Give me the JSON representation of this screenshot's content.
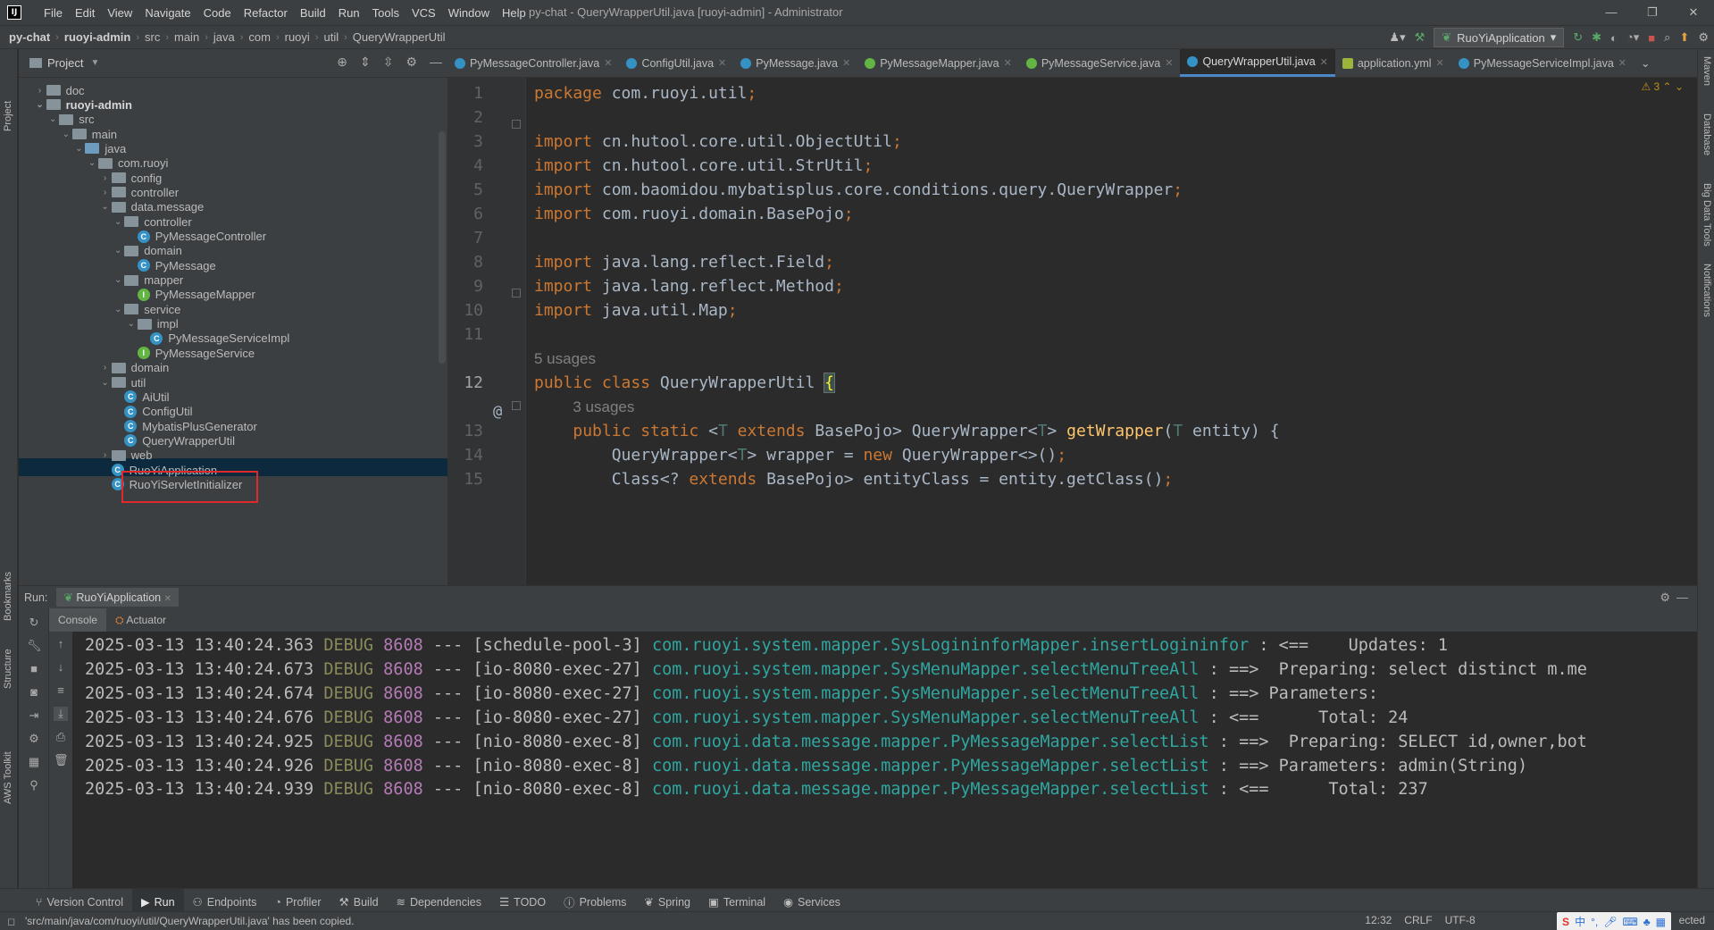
{
  "window": {
    "title": "py-chat - QueryWrapperUtil.java [ruoyi-admin] - Administrator",
    "menus": [
      "File",
      "Edit",
      "View",
      "Navigate",
      "Code",
      "Refactor",
      "Build",
      "Run",
      "Tools",
      "VCS",
      "Window",
      "Help"
    ],
    "controls": [
      "—",
      "❐",
      "✕"
    ]
  },
  "breadcrumb": [
    "py-chat",
    "ruoyi-admin",
    "src",
    "main",
    "java",
    "com",
    "ruoyi",
    "util",
    "QueryWrapperUtil"
  ],
  "run_config": "RuoYiApplication",
  "project_panel": {
    "title": "Project",
    "tree": [
      {
        "label": "doc",
        "depth": 1,
        "type": "folder",
        "arrow": "›"
      },
      {
        "label": "ruoyi-admin",
        "depth": 1,
        "type": "module",
        "arrow": "⌄"
      },
      {
        "label": "src",
        "depth": 2,
        "type": "folder",
        "arrow": "⌄"
      },
      {
        "label": "main",
        "depth": 3,
        "type": "folder",
        "arrow": "⌄"
      },
      {
        "label": "java",
        "depth": 4,
        "type": "source",
        "arrow": "⌄"
      },
      {
        "label": "com.ruoyi",
        "depth": 5,
        "type": "package",
        "arrow": "⌄"
      },
      {
        "label": "config",
        "depth": 6,
        "type": "package",
        "arrow": "›"
      },
      {
        "label": "controller",
        "depth": 6,
        "type": "package",
        "arrow": "›"
      },
      {
        "label": "data.message",
        "depth": 6,
        "type": "package",
        "arrow": "⌄"
      },
      {
        "label": "controller",
        "depth": 7,
        "type": "package",
        "arrow": "⌄"
      },
      {
        "label": "PyMessageController",
        "depth": 8,
        "type": "class",
        "arrow": ""
      },
      {
        "label": "domain",
        "depth": 7,
        "type": "package",
        "arrow": "⌄"
      },
      {
        "label": "PyMessage",
        "depth": 8,
        "type": "class",
        "arrow": ""
      },
      {
        "label": "mapper",
        "depth": 7,
        "type": "package",
        "arrow": "⌄"
      },
      {
        "label": "PyMessageMapper",
        "depth": 8,
        "type": "interface",
        "arrow": ""
      },
      {
        "label": "service",
        "depth": 7,
        "type": "package",
        "arrow": "⌄"
      },
      {
        "label": "impl",
        "depth": 8,
        "type": "package",
        "arrow": "⌄"
      },
      {
        "label": "PyMessageServiceImpl",
        "depth": 9,
        "type": "class",
        "arrow": ""
      },
      {
        "label": "PyMessageService",
        "depth": 8,
        "type": "interface",
        "arrow": ""
      },
      {
        "label": "domain",
        "depth": 6,
        "type": "package",
        "arrow": "›"
      },
      {
        "label": "util",
        "depth": 6,
        "type": "package",
        "arrow": "⌄"
      },
      {
        "label": "AiUtil",
        "depth": 7,
        "type": "class",
        "arrow": ""
      },
      {
        "label": "ConfigUtil",
        "depth": 7,
        "type": "class",
        "arrow": ""
      },
      {
        "label": "MybatisPlusGenerator",
        "depth": 7,
        "type": "class",
        "arrow": ""
      },
      {
        "label": "QueryWrapperUtil",
        "depth": 7,
        "type": "class",
        "arrow": "",
        "selected": true
      },
      {
        "label": "web",
        "depth": 6,
        "type": "package",
        "arrow": "›"
      },
      {
        "label": "RuoYiApplication",
        "depth": 6,
        "type": "class",
        "arrow": ""
      },
      {
        "label": "RuoYiServletInitializer",
        "depth": 6,
        "type": "class",
        "arrow": ""
      }
    ]
  },
  "editor_tabs": [
    {
      "label": "PyMessageController.java",
      "kind": "class"
    },
    {
      "label": "ConfigUtil.java",
      "kind": "class"
    },
    {
      "label": "PyMessage.java",
      "kind": "class"
    },
    {
      "label": "PyMessageMapper.java",
      "kind": "interface"
    },
    {
      "label": "PyMessageService.java",
      "kind": "interface"
    },
    {
      "label": "QueryWrapperUtil.java",
      "kind": "class",
      "active": true
    },
    {
      "label": "application.yml",
      "kind": "yml"
    },
    {
      "label": "PyMessageServiceImpl.java",
      "kind": "class"
    }
  ],
  "editor": {
    "warnings": "3",
    "lines": [
      {
        "n": "1",
        "html": "<span class='kw'>package</span> com.ruoyi.util<span class='kw'>;</span>"
      },
      {
        "n": "2",
        "html": ""
      },
      {
        "n": "3",
        "html": "<span class='kw'>import</span> cn.hutool.core.util.ObjectUtil<span class='kw'>;</span>"
      },
      {
        "n": "4",
        "html": "<span class='kw'>import</span> cn.hutool.core.util.StrUtil<span class='kw'>;</span>"
      },
      {
        "n": "5",
        "html": "<span class='kw'>import</span> com.baomidou.mybatisplus.core.conditions.query.QueryWrapper<span class='kw'>;</span>"
      },
      {
        "n": "6",
        "html": "<span class='kw'>import</span> com.ruoyi.domain.BasePojo<span class='kw'>;</span>"
      },
      {
        "n": "7",
        "html": ""
      },
      {
        "n": "8",
        "html": "<span class='kw'>import</span> java.lang.reflect.Field<span class='kw'>;</span>"
      },
      {
        "n": "9",
        "html": "<span class='kw'>import</span> java.lang.reflect.Method<span class='kw'>;</span>"
      },
      {
        "n": "10",
        "html": "<span class='kw'>import</span> java.util.Map<span class='kw'>;</span>"
      },
      {
        "n": "11",
        "html": ""
      },
      {
        "n": "",
        "html": "<span class='hint'>5 usages</span>"
      },
      {
        "n": "12",
        "html": "<span class='kw'>public class</span> QueryWrapperUtil <span class='brace-hl'>{</span>",
        "current": true
      },
      {
        "n": "",
        "html": "    <span class='hint'>3 usages</span>"
      },
      {
        "n": "13",
        "html": "    <span class='kw'>public static</span> &lt;<span class='ty'>T</span> <span class='kw'>extends</span> BasePojo&gt; QueryWrapper&lt;<span class='ty'>T</span>&gt; <span class='fn'>getWrapper</span>(<span class='ty'>T</span> entity) {"
      },
      {
        "n": "14",
        "html": "        QueryWrapper&lt;<span class='ty'>T</span>&gt; wrapper = <span class='kw'>new</span> QueryWrapper&lt;&gt;()<span class='kw'>;</span>"
      },
      {
        "n": "15",
        "html": "        Class&lt;? <span class='kw'>extends</span> BasePojo&gt; entityClass = entity.getClass()<span class='kw'>;</span>"
      }
    ]
  },
  "run_panel": {
    "label": "Run:",
    "tab": "RuoYiApplication",
    "subtabs": [
      "Console",
      "Actuator"
    ],
    "logs": [
      {
        "ts": "2025-03-13 13:40:24.363",
        "lvl": "DEBUG",
        "pid": "8608",
        "thread": "[schedule-pool-3]",
        "cls": "com.ruoyi.system.mapper.SysLogininforMapper.insertLogininfor",
        "msg": " : <==    Updates: 1"
      },
      {
        "ts": "2025-03-13 13:40:24.673",
        "lvl": "DEBUG",
        "pid": "8608",
        "thread": "[io-8080-exec-27]",
        "cls": "com.ruoyi.system.mapper.SysMenuMapper.selectMenuTreeAll",
        "msg": " : ==>  Preparing: select distinct m.me"
      },
      {
        "ts": "2025-03-13 13:40:24.674",
        "lvl": "DEBUG",
        "pid": "8608",
        "thread": "[io-8080-exec-27]",
        "cls": "com.ruoyi.system.mapper.SysMenuMapper.selectMenuTreeAll",
        "msg": " : ==> Parameters: "
      },
      {
        "ts": "2025-03-13 13:40:24.676",
        "lvl": "DEBUG",
        "pid": "8608",
        "thread": "[io-8080-exec-27]",
        "cls": "com.ruoyi.system.mapper.SysMenuMapper.selectMenuTreeAll",
        "msg": " : <==      Total: 24"
      },
      {
        "ts": "2025-03-13 13:40:24.925",
        "lvl": "DEBUG",
        "pid": "8608",
        "thread": "[nio-8080-exec-8]",
        "cls": "com.ruoyi.data.message.mapper.PyMessageMapper.selectList",
        "msg": " : ==>  Preparing: SELECT id,owner,bot"
      },
      {
        "ts": "2025-03-13 13:40:24.926",
        "lvl": "DEBUG",
        "pid": "8608",
        "thread": "[nio-8080-exec-8]",
        "cls": "com.ruoyi.data.message.mapper.PyMessageMapper.selectList",
        "msg": " : ==> Parameters: admin(String)"
      },
      {
        "ts": "2025-03-13 13:40:24.939",
        "lvl": "DEBUG",
        "pid": "8608",
        "thread": "[nio-8080-exec-8]",
        "cls": "com.ruoyi.data.message.mapper.PyMessageMapper.selectList",
        "msg": " : <==      Total: 237"
      }
    ]
  },
  "bottom_tabs": [
    {
      "label": "Version Control",
      "icon": "⑂"
    },
    {
      "label": "Run",
      "icon": "▶",
      "active": true
    },
    {
      "label": "Endpoints",
      "icon": "⚇"
    },
    {
      "label": "Profiler",
      "icon": "◔"
    },
    {
      "label": "Build",
      "icon": "⚒"
    },
    {
      "label": "Dependencies",
      "icon": "≋"
    },
    {
      "label": "TODO",
      "icon": "☰"
    },
    {
      "label": "Problems",
      "icon": "ⓘ"
    },
    {
      "label": "Spring",
      "icon": "❦"
    },
    {
      "label": "Terminal",
      "icon": "▣"
    },
    {
      "label": "Services",
      "icon": "◉"
    }
  ],
  "statusbar": {
    "message": "'src/main/java/com/ruoyi/util/QueryWrapperUtil.java' has been copied.",
    "position": "12:32",
    "line_sep": "CRLF",
    "encoding": "UTF-8",
    "extra": "ected"
  },
  "side_labels": {
    "left": [
      "Project",
      "Bookmarks",
      "Structure",
      "AWS Toolkit"
    ],
    "right": [
      "Maven",
      "Database",
      "Big Data Tools",
      "Notifications"
    ]
  },
  "colors": {
    "accent": "#4a88c7",
    "selection": "#0d293e",
    "highlight_box": "#e0292b"
  }
}
